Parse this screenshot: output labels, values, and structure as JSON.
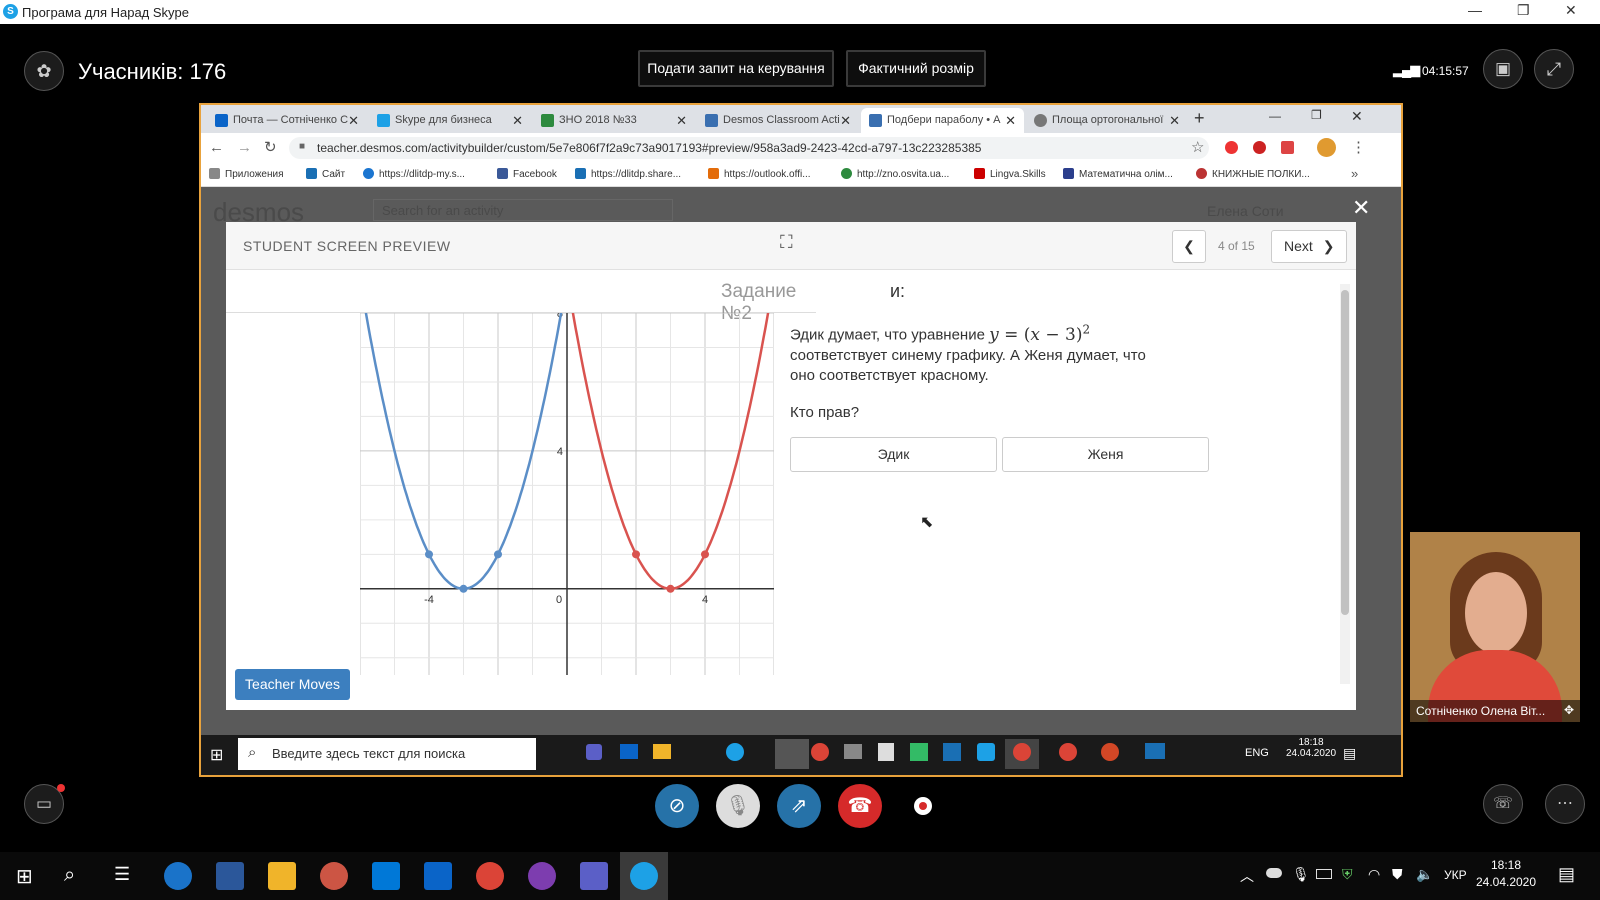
{
  "window": {
    "title": "Програма для Нарад Skype"
  },
  "skype": {
    "participants": "Учасників: 176",
    "request_control": "Подати запит на керування",
    "actual_size": "Фактичний розмір",
    "clock": "04:15:57",
    "webcam_name": "Сотніченко Олена Віт..."
  },
  "browser": {
    "tabs": [
      {
        "label": "Почта — Сотніченко С",
        "color": "#0a64c8"
      },
      {
        "label": "Skype для бизнеса",
        "color": "#1da1e6"
      },
      {
        "label": "ЗНО 2018 №33",
        "color": "#2d8a3e"
      },
      {
        "label": "Desmos Classroom Acti",
        "color": "#3a6fb0"
      },
      {
        "label": "Подбери параболу • А",
        "color": "#3a6fb0"
      },
      {
        "label": "Площа ортогональної",
        "color": "#666"
      }
    ],
    "url": "teacher.desmos.com/activitybuilder/custom/5e7e806f7f2a9c73a9017193#preview/958a3ad9-2423-42cd-a797-13c223285385",
    "bookmarks": [
      "Приложения",
      "Сайт",
      "https://dlitdp-my.s...",
      "Facebook",
      "https://dlitdp.share...",
      "https://outlook.offi...",
      "http://zno.osvita.ua...",
      "Lingva.Skills",
      "Математична олім...",
      "КНИЖНЫЕ ПОЛКИ..."
    ]
  },
  "desmos": {
    "bg_logo": "desmos",
    "bg_search": "Search for an activity",
    "bg_user": "Елена Соти",
    "preview_label": "STUDENT SCREEN PREVIEW",
    "page": "4 of 15",
    "next": "Next",
    "task_title": "Задание №2",
    "task_tail": "и:",
    "q1_a": "Эдик думает, что уравнение",
    "q1_y": "y",
    "q1_eq": " = (",
    "q1_x": "x",
    "q1_rest": " − 3)",
    "q1_exp": "2",
    "q1_b": "соответствует синему графику. А Женя думает, что",
    "q1_c": "оно соответствует красному.",
    "q2": "Кто прав?",
    "opt1": "Эдик",
    "opt2": "Женя",
    "teacher_moves": "Teacher Moves"
  },
  "chart_data": {
    "type": "line",
    "xlim": [
      -6,
      6
    ],
    "ylim": [
      -2.5,
      8
    ],
    "xticks": [
      "-4",
      "0",
      "4"
    ],
    "yticks": [
      "4",
      "8"
    ],
    "grid": true,
    "series": [
      {
        "color": "#5b8ec7",
        "x": [
          -6,
          -5,
          -4,
          -3,
          -2,
          -1,
          0
        ],
        "y": [
          9,
          4,
          1,
          0,
          1,
          4,
          9
        ],
        "points": [
          [
            -4,
            1
          ],
          [
            -3,
            0
          ],
          [
            -2,
            1
          ]
        ]
      },
      {
        "color": "#d9534f",
        "x": [
          0,
          1,
          2,
          3,
          4,
          5,
          6
        ],
        "y": [
          9,
          4,
          1,
          0,
          1,
          4,
          9
        ],
        "points": [
          [
            2,
            1
          ],
          [
            3,
            0
          ],
          [
            4,
            1
          ]
        ]
      }
    ]
  },
  "inner_taskbar": {
    "search": "Введите здесь текст для поиска",
    "lang": "ENG",
    "time": "18:18",
    "date": "24.04.2020"
  },
  "outer_taskbar": {
    "lang": "УКР",
    "time": "18:18",
    "date": "24.04.2020"
  }
}
